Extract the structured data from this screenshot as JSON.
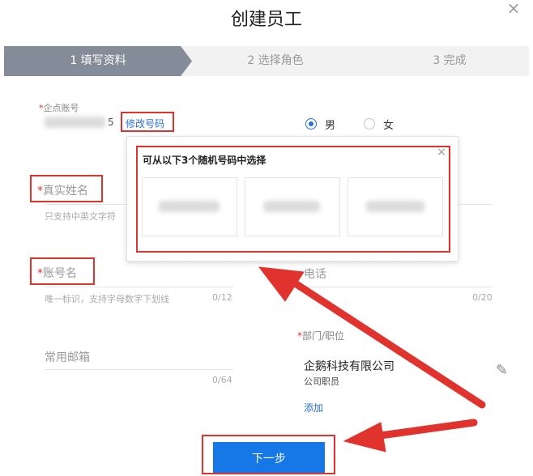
{
  "dialog": {
    "title": "创建员工",
    "close_icon": "×"
  },
  "stepper": {
    "steps": [
      "1 填写资料",
      "2 选择角色",
      "3 完成"
    ]
  },
  "form": {
    "account": {
      "label": "企点账号",
      "required_mark": "*",
      "suffix_char": "5",
      "change_link": "修改号码"
    },
    "gender": {
      "options": [
        "男",
        "女"
      ],
      "selected": "男"
    },
    "real_name": {
      "label": "真实姓名",
      "required_mark": "*",
      "hint": "只支持中英文字符"
    },
    "account_name": {
      "label": "账号名",
      "required_mark": "*",
      "hint": "唯一标识，支持字母数字下划线",
      "count": "0/12"
    },
    "phone": {
      "label": "电话",
      "count": "0/20"
    },
    "email": {
      "label": "常用邮箱",
      "count": "0/64"
    },
    "department": {
      "label": "部门/职位",
      "required_mark": "*",
      "company": "企鹅科技有限公司",
      "position": "公司职员",
      "add_link": "添加",
      "edit_icon": "✎"
    }
  },
  "popup": {
    "title": "可从以下3个随机号码中选择",
    "close_icon": "×",
    "options_count": 3
  },
  "footer": {
    "next_label": "下一步"
  },
  "colors": {
    "accent": "#1677e6",
    "required": "#e0332e",
    "highlight": "#e0332e",
    "link": "#2a6fd8",
    "stepper_active": "#858c99"
  }
}
